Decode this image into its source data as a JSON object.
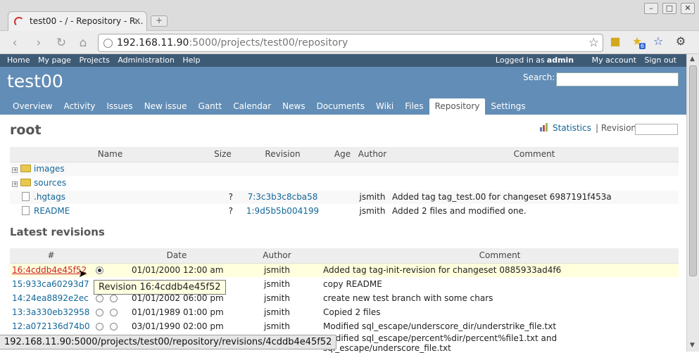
{
  "browser": {
    "tab_title": "test00 - / - Repository - R...",
    "url_host": "192.168.11.90",
    "url_rest": ":5000/projects/test00/repository",
    "status_url": "192.168.11.90:5000/projects/test00/repository/revisions/4cddb4e45f52",
    "extension_badge": "6"
  },
  "topmenu": {
    "left": [
      "Home",
      "My page",
      "Projects",
      "Administration",
      "Help"
    ],
    "logged_in_prefix": "Logged in as",
    "user": "admin",
    "my_account": "My account",
    "sign_out": "Sign out"
  },
  "header": {
    "project": "test00",
    "search_label": "Search:"
  },
  "mainmenu": [
    "Overview",
    "Activity",
    "Issues",
    "New issue",
    "Gantt",
    "Calendar",
    "News",
    "Documents",
    "Wiki",
    "Files",
    "Repository",
    "Settings"
  ],
  "repo": {
    "heading": "root",
    "statistics": "Statistics",
    "separator": "|",
    "revision_label": "Revision:",
    "columns": [
      "Name",
      "Size",
      "Revision",
      "Age",
      "Author",
      "Comment"
    ],
    "entries": [
      {
        "name": "images",
        "kind": "dir",
        "size": "",
        "revision": "",
        "age": "",
        "author": "",
        "comment": ""
      },
      {
        "name": "sources",
        "kind": "dir",
        "size": "",
        "revision": "",
        "age": "",
        "author": "",
        "comment": ""
      },
      {
        "name": ".hgtags",
        "kind": "file",
        "size": "?",
        "revision": "7:3c3b3c8cba58",
        "age": "",
        "author": "jsmith",
        "comment": "Added tag tag_test.00 for changeset 6987191f453a"
      },
      {
        "name": "README",
        "kind": "file",
        "size": "?",
        "revision": "1:9d5b5b004199",
        "age": "",
        "author": "jsmith",
        "comment": "Added 2 files and modified one."
      }
    ]
  },
  "latest": {
    "heading": "Latest revisions",
    "columns": [
      "#",
      "",
      "",
      "Date",
      "Author",
      "Comment"
    ],
    "rows": [
      {
        "rev": "16:4cddb4e45f52",
        "date": "01/01/2000 12:00 am",
        "author": "jsmith",
        "comment": "Added tag tag-init-revision for changeset 0885933ad4f6"
      },
      {
        "rev": "15:933ca60293d7",
        "date": "",
        "author": "jsmith",
        "comment": "copy README"
      },
      {
        "rev": "14:24ea8892e2ec",
        "date": "01/01/2002 06:00 pm",
        "author": "jsmith",
        "comment": "create new test branch with some chars"
      },
      {
        "rev": "13:3a330eb32958",
        "date": "01/01/1989 01:00 pm",
        "author": "jsmith",
        "comment": "Copied 2 files"
      },
      {
        "rev": "12:a072136d74b0",
        "date": "03/01/1990 02:00 pm",
        "author": "jsmith",
        "comment": "Modified sql_escape/underscore_dir/understrike_file.txt"
      },
      {
        "rev": "",
        "date": "",
        "author": "",
        "comment": "Modified sql_escape/percent%dir/percent%file1.txt and sql_escape/underscore_file.txt"
      }
    ],
    "tooltip": "Revision 16:4cddb4e45f52"
  },
  "colors": {
    "topmenu": "#3e5b76",
    "header": "#628db6",
    "link": "#169",
    "highlight_row": "#ffffdd"
  }
}
